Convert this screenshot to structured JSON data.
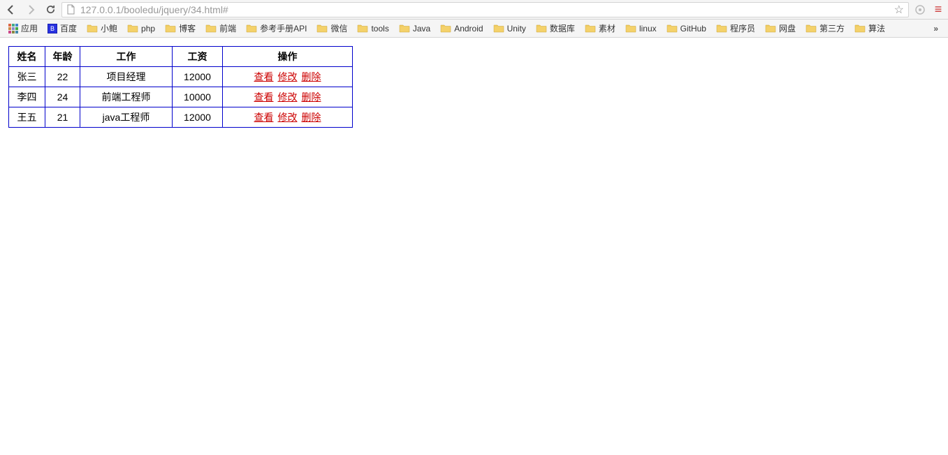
{
  "browser": {
    "url": "127.0.0.1/booledu/jquery/34.html#"
  },
  "bookmarks": {
    "apps_label": "应用",
    "baidu_label": "百度",
    "folders": [
      "小鲍",
      "php",
      "博客",
      "前端",
      "参考手册API",
      "微信",
      "tools",
      "Java",
      "Android",
      "Unity",
      "数据库",
      "素材",
      "linux",
      "GitHub",
      "程序员",
      "网盘",
      "第三方",
      "算法"
    ],
    "overflow": "»"
  },
  "table": {
    "headers": {
      "name": "姓名",
      "age": "年龄",
      "job": "工作",
      "salary": "工资",
      "action": "操作"
    },
    "actions": {
      "view": "查看",
      "edit": "修改",
      "delete": "删除"
    },
    "rows": [
      {
        "name": "张三",
        "age": "22",
        "job": "项目经理",
        "salary": "12000"
      },
      {
        "name": "李四",
        "age": "24",
        "job": "前端工程师",
        "salary": "10000"
      },
      {
        "name": "王五",
        "age": "21",
        "job": "java工程师",
        "salary": "12000"
      }
    ]
  }
}
